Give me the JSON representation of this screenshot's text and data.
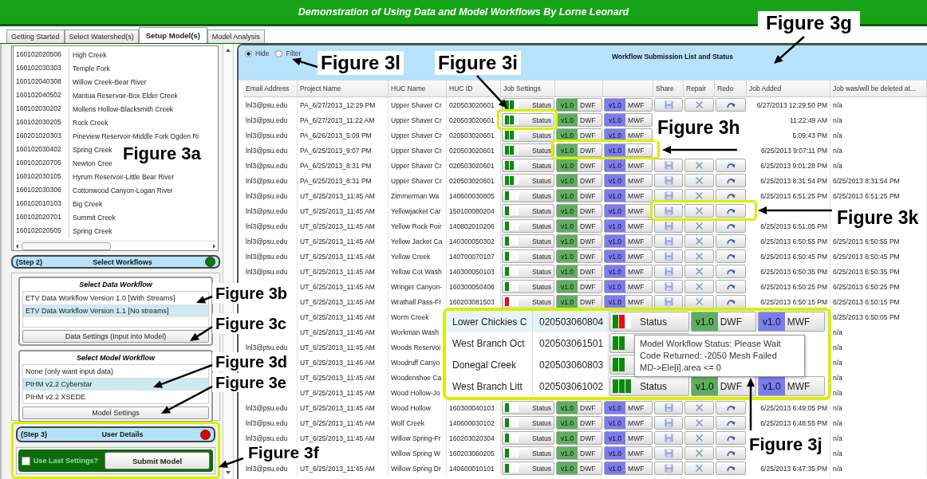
{
  "banner": {
    "title": "Demonstration of Using Data and Model Workflows By Lorne Leonard"
  },
  "tabs": [
    {
      "label": "Getting Started",
      "selected": false
    },
    {
      "label": "Select Watershed(s)",
      "selected": false
    },
    {
      "label": "Setup Model(s)",
      "selected": true
    },
    {
      "label": "Model Analysis",
      "selected": false
    }
  ],
  "watersheds": [
    {
      "id": "160102020506",
      "name": "High Creek"
    },
    {
      "id": "160102030303",
      "name": "Temple Fork"
    },
    {
      "id": "160102040308",
      "name": "Willow Creek-Bear River"
    },
    {
      "id": "160102040502",
      "name": "Mantua Reservoir-Box Elder Creek"
    },
    {
      "id": "160102030202",
      "name": "Mollens Hollow-Blacksmith Creek"
    },
    {
      "id": "160102030205",
      "name": "Rock Creek"
    },
    {
      "id": "160201020303",
      "name": "Pineview Reservoir-Middle Fork Ogden Ri"
    },
    {
      "id": "160102030402",
      "name": "Spring Creek"
    },
    {
      "id": "160102020705",
      "name": "Newton Cree"
    },
    {
      "id": "160102030105",
      "name": "Hyrum Reservoir-Little Bear River"
    },
    {
      "id": "160102030306",
      "name": "Cottonwood Canyon-Logan River"
    },
    {
      "id": "160102010103",
      "name": "Big Creek"
    },
    {
      "id": "160102020701",
      "name": "Summit Creek"
    },
    {
      "id": "160102020505",
      "name": "Spring Creek"
    }
  ],
  "step2": {
    "step": "(Step 2)",
    "title": "Select Workflows",
    "color": "#0a7a0a"
  },
  "data_workflow": {
    "title": "Select Data Workflow",
    "items": [
      {
        "label": "ETV Data Workflow Version 1.0 [With Streams]",
        "selected": false
      },
      {
        "label": "ETV Data Workflow Version 1.1 [No streams]",
        "selected": true
      }
    ],
    "button": "Data Settings (Input into Model)"
  },
  "model_workflow": {
    "title": "Select Model Workflow",
    "items": [
      {
        "label": "None (only want input data)",
        "selected": false
      },
      {
        "label": "PIHM v2.2 Cyberstar",
        "selected": true
      },
      {
        "label": "PIHM v2.2 XSEDE",
        "selected": false
      }
    ],
    "button": "Model Settings"
  },
  "step3": {
    "step": "(Step 3)",
    "title": "User Details",
    "color": "#e00000"
  },
  "user_details": {
    "checkbox": {
      "label": "Use Last Settings?",
      "checked": false
    },
    "button": "Submit Model"
  },
  "submissions": {
    "filter": [
      {
        "label": "Hide",
        "selected": true
      },
      {
        "label": "Filter",
        "selected": false
      }
    ],
    "title": "Workflow Submission List and Status",
    "headers": {
      "email": "Email Address",
      "project": "Project Name",
      "huc_name": "HUC Name",
      "huc_id": "HUC ID",
      "job_settings": "Job Settings",
      "share": "Share",
      "repair": "Repair",
      "redo": "Redo",
      "job_added": "Job Added",
      "job_deleted": "Job was/will be deleted at..."
    },
    "rows": [
      {
        "email": "lnl3@psu.edu",
        "project": "PA_6/27/2013_12:29 PM",
        "huc_name": "Upper Shaver Cr",
        "huc_id": "020503020601",
        "status": {
          "segments": [
            {
              "color": "#0b8a0b"
            },
            {
              "color": "#0b8a0b"
            },
            {
              "color": "#ffffff"
            }
          ],
          "label": "Status"
        },
        "dwf_version": "v1.0",
        "dwf": "DWF",
        "mwf_version": "v1.0",
        "mwf": "MWF",
        "tools": true,
        "job_added": "6/27/2013 12:29:50 PM",
        "job_deleted": "n/a"
      },
      {
        "email": "lnl3@psu.edu",
        "project": "PA_6/27/2013_11:22 AM",
        "huc_name": "Upper Shaver Cr",
        "huc_id": "020503020601",
        "status": {
          "segments": [
            {
              "color": "#0b8a0b"
            },
            {
              "color": "#0b8a0b"
            },
            {
              "color": "#ffffff"
            }
          ],
          "label": "Status"
        },
        "dwf_version": "v1.0",
        "dwf": "DWF",
        "mwf_version": "v1.0",
        "mwf": "MWF",
        "tools": false,
        "job_added": "11:22:49 AM",
        "job_deleted": "n/a"
      },
      {
        "email": "lnl3@psu.edu",
        "project": "PA_6/26/2013_5:09 PM",
        "huc_name": "Upper Shaver Cr",
        "huc_id": "020503020601",
        "status": {
          "segments": [
            {
              "color": "#0b8a0b"
            },
            {
              "color": "#0b8a0b"
            },
            {
              "color": "#ffffff"
            }
          ],
          "label": "Status"
        },
        "dwf_version": "v1.0",
        "dwf": "DWF",
        "mwf_version": "v1.0",
        "mwf": "MWF",
        "tools": false,
        "job_added": "5:09:43 PM",
        "job_deleted": "n/a"
      },
      {
        "email": "lnl3@psu.edu",
        "project": "PA_6/25/2013_9:07 PM",
        "huc_name": "Upper Shaver Cr",
        "huc_id": "020503020601",
        "status": {
          "segments": [
            {
              "color": "#0b8a0b"
            },
            {
              "color": "#0b8a0b"
            },
            {
              "color": "#ffffff"
            }
          ],
          "label": "Status"
        },
        "dwf_version": "v1.0",
        "dwf": "DWF",
        "mwf_version": "v1.0",
        "mwf": "MWF",
        "tools": false,
        "job_added": "6/25/2013 9:07:11 PM",
        "job_deleted": "n/a"
      },
      {
        "email": "lnl3@psu.edu",
        "project": "PA_6/25/2013_8:31 PM",
        "huc_name": "Upper Shaver Cr",
        "huc_id": "020503020601",
        "status": {
          "segments": [
            {
              "color": "#0b8a0b"
            },
            {
              "color": "#0b8a0b"
            },
            {
              "color": "#ffffff"
            }
          ],
          "label": "Status"
        },
        "dwf_version": "v1.0",
        "dwf": "DWF",
        "mwf_version": "v1.0",
        "mwf": "MWF",
        "tools": true,
        "job_added": "6/25/2013 9:01:28 PM",
        "job_deleted": "n/a"
      },
      {
        "email": "lnl3@psu.edu",
        "project": "PA_6/25/2013_8:31 PM",
        "huc_name": "Upper Shaver Cr",
        "huc_id": "020503020601",
        "status": {
          "segments": [
            {
              "color": "#0b8a0b"
            },
            {
              "color": "#0b8a0b"
            },
            {
              "color": "#ffffff"
            }
          ],
          "label": "Status"
        },
        "dwf_version": "v1.0",
        "dwf": "DWF",
        "mwf_version": "v1.0",
        "mwf": "MWF",
        "tools": true,
        "job_added": "6/25/2013 8:31:54 PM",
        "job_deleted": "6/25/2013 8:31:54 PM"
      },
      {
        "email": "lnl3@psu.edu",
        "project": "UT_6/25/2013_11:45 AM",
        "huc_name": "Zimmerman Wa",
        "huc_id": "140600030805",
        "status": {
          "segments": [
            {
              "color": "#0b8a0b"
            },
            {
              "color": "#ffffff"
            },
            {
              "color": "#ffffff"
            }
          ],
          "label": "Status"
        },
        "dwf_version": "v1.0",
        "dwf": "DWF",
        "mwf_version": "v1.0",
        "mwf": "MWF",
        "tools": true,
        "job_added": "6/25/2013 6:51:25 PM",
        "job_deleted": "6/25/2013 6:51:25 PM"
      },
      {
        "email": "lnl3@psu.edu",
        "project": "UT_6/25/2013_11:45 AM",
        "huc_name": "Yellowjacket Car",
        "huc_id": "150100080204",
        "status": {
          "segments": [
            {
              "color": "#0b8a0b"
            },
            {
              "color": "#ffffff"
            },
            {
              "color": "#ffffff"
            }
          ],
          "label": "Status"
        },
        "dwf_version": "v1.0",
        "dwf": "DWF",
        "mwf_version": "v1.0",
        "mwf": "MWF",
        "tools": true
      },
      {
        "email": "lnl3@psu.edu",
        "project": "UT_6/25/2013_11:45 AM",
        "huc_name": "Yellow Rock Poir",
        "huc_id": "140802010206",
        "status": {
          "segments": [
            {
              "color": "#0b8a0b"
            },
            {
              "color": "#ffffff"
            },
            {
              "color": "#ffffff"
            }
          ],
          "label": "Status"
        },
        "dwf_version": "v1.0",
        "dwf": "DWF",
        "mwf_version": "v1.0",
        "mwf": "MWF",
        "tools": true,
        "job_added": "6/25/2013 6:51:05 PM"
      },
      {
        "email": "lnl3@psu.edu",
        "project": "UT_6/25/2013_11:45 AM",
        "huc_name": "Yellow Jacket Ca",
        "huc_id": "140300050302",
        "status": {
          "segments": [
            {
              "color": "#0b8a0b"
            },
            {
              "color": "#ffffff"
            },
            {
              "color": "#ffffff"
            }
          ],
          "label": "Status"
        },
        "dwf_version": "v1.0",
        "dwf": "DWF",
        "mwf_version": "v1.0",
        "mwf": "MWF",
        "tools": true,
        "job_added": "6/25/2013 6:50:55 PM",
        "job_deleted": "6/25/2013 6:50:55 PM"
      },
      {
        "email": "lnl3@psu.edu",
        "project": "UT_6/25/2013_11:45 AM",
        "huc_name": "Yellow Creek",
        "huc_id": "140700070107",
        "status": {
          "segments": [
            {
              "color": "#0b8a0b"
            },
            {
              "color": "#ffffff"
            },
            {
              "color": "#ffffff"
            }
          ],
          "label": "Status"
        },
        "dwf_version": "v1.0",
        "dwf": "DWF",
        "mwf_version": "v1.0",
        "mwf": "MWF",
        "tools": true,
        "job_added": "6/25/2013 6:50:45 PM",
        "job_deleted": "6/25/2013 6:50:45 PM"
      },
      {
        "email": "lnl3@psu.edu",
        "project": "UT_6/25/2013_11:45 AM",
        "huc_name": "Yellow Cot Wash",
        "huc_id": "140300050103",
        "status": {
          "segments": [
            {
              "color": "#0b8a0b"
            },
            {
              "color": "#ffffff"
            },
            {
              "color": "#ffffff"
            }
          ],
          "label": "Status"
        },
        "dwf_version": "v1.0",
        "dwf": "DWF",
        "mwf_version": "v1.0",
        "mwf": "MWF",
        "tools": true,
        "job_added": "6/25/2013 6:50:35 PM",
        "job_deleted": "6/25/2013 6:50:35 PM"
      },
      {
        "project": "UT_6/25/2013_11:45 AM",
        "huc_name": "Wringer Canyon-",
        "huc_id": "160300050406",
        "status": {
          "segments": [
            {
              "color": "#0b8a0b"
            },
            {
              "color": "#ffffff"
            },
            {
              "color": "#ffffff"
            }
          ],
          "label": "Status"
        },
        "dwf_version": "v1.0",
        "dwf": "DWF",
        "mwf_version": "v1.0",
        "mwf": "MWF",
        "tools": true,
        "job_added": "6/25/2013 6:50:25 PM",
        "job_deleted": "6/25/2013 6:50:25 PM"
      },
      {
        "project": "UT_6/25/2013_11:45 AM",
        "huc_name": "Wrathall Pass-Fr",
        "huc_id": "160203081503",
        "status": {
          "segments": [
            {
              "color": "#e01010"
            },
            {
              "color": "#ffffff"
            },
            {
              "color": "#ffffff"
            }
          ],
          "label": "Status"
        },
        "dwf_version": "v1.0",
        "dwf": "DWF",
        "mwf_version": "v1.0",
        "mwf": "MWF",
        "tools": true,
        "job_added": "6/25/2013 6:50:15 PM",
        "job_deleted": "6/25/2013 6:50:15 PM"
      },
      {
        "project": "UT_6/25/2013_11:45 AM",
        "huc_name": "Worm Creek",
        "tools": false,
        "job_deleted": "6/25/2013 6:50:05 PM"
      },
      {
        "project": "UT_6/25/2013_11:45 AM",
        "huc_name": "Workman Wash",
        "tools": false,
        "job_deleted": "n/a"
      },
      {
        "email": "lnl3@psu.edu",
        "project": "UT_6/25/2013_11:45 AM",
        "huc_name": "Woods Reservoi",
        "tools": false,
        "job_deleted": "n/a"
      },
      {
        "project": "UT_6/25/2013_11:45 AM",
        "huc_name": "Woodruff Canyo",
        "tools": false,
        "job_deleted": "n/a"
      },
      {
        "project": "UT_6/25/2013_11:45 AM",
        "huc_name": "Woodenshoe Ca",
        "tools": false,
        "job_deleted": "n/a"
      },
      {
        "project": "UT_6/25/2013_11:45 AM",
        "huc_name": "Wood Hollow-Jo",
        "tools": false,
        "job_deleted": "n/a"
      },
      {
        "email": "lnl3@psu.edu",
        "project": "UT_6/25/2013_11:45 AM",
        "huc_name": "Wood Hollow",
        "huc_id": "160300040103",
        "status": {
          "segments": [
            {
              "color": "#0b8a0b"
            },
            {
              "color": "#ffffff"
            },
            {
              "color": "#ffffff"
            }
          ],
          "label": "Status"
        },
        "dwf_version": "v1.0",
        "dwf": "DWF",
        "mwf_version": "v1.0",
        "mwf": "MWF",
        "tools": true,
        "job_added": "6/25/2013 6:49:05 PM",
        "job_deleted": "n/a"
      },
      {
        "email": "lnl3@psu.edu",
        "project": "UT_6/25/2013_11:45 AM",
        "huc_name": "Wolf Creek",
        "huc_id": "140600030102",
        "status": {
          "segments": [
            {
              "color": "#0b8a0b"
            },
            {
              "color": "#ffffff"
            },
            {
              "color": "#ffffff"
            }
          ],
          "label": "Status"
        },
        "dwf_version": "v1.0",
        "dwf": "DWF",
        "mwf_version": "v1.0",
        "mwf": "MWF",
        "tools": true,
        "job_added": "6/25/2013 6:48:55 PM",
        "job_deleted": "n/a"
      },
      {
        "email": "lnl3@psu.edu",
        "project": "UT_6/25/2013_11:45 AM",
        "huc_name": "Willow Spring-Fr",
        "huc_id": "160203020304",
        "status": {
          "segments": [
            {
              "color": "#0b8a0b"
            },
            {
              "color": "#ffffff"
            },
            {
              "color": "#ffffff"
            }
          ],
          "label": "Status"
        },
        "dwf_version": "v1.0",
        "dwf": "DWF",
        "mwf_version": "v1.0",
        "mwf": "MWF",
        "tools": true,
        "job_deleted": "n/a"
      },
      {
        "huc_name": "Willow Spring W",
        "huc_id": "160203060205",
        "status": {
          "segments": [
            {
              "color": "#0b8a0b"
            },
            {
              "color": "#ffffff"
            },
            {
              "color": "#ffffff"
            }
          ],
          "label": "Status"
        },
        "dwf_version": "v1.0",
        "dwf": "DWF",
        "mwf_version": "v1.0",
        "mwf": "MWF",
        "tools": true,
        "job_deleted": "n/a"
      },
      {
        "email": "lnl3@psu.edu",
        "project": "UT_6/25/2013_11:45 AM",
        "huc_name": "Willow Spring Dr",
        "huc_id": "140600010101",
        "status": {
          "segments": [
            {
              "color": "#0b8a0b"
            },
            {
              "color": "#ffffff"
            },
            {
              "color": "#ffffff"
            }
          ],
          "label": "Status"
        },
        "dwf_version": "v1.0",
        "dwf": "DWF",
        "mwf_version": "v1.0",
        "mwf": "MWF",
        "tools": true,
        "job_added": "6/25/2013 6:47:35 PM",
        "job_deleted": "n/a"
      }
    ]
  },
  "inset": {
    "rows": [
      {
        "selected": true,
        "huc_name": "Lower Chickies C",
        "huc_id": "020503060804",
        "status": {
          "segments": [
            {
              "color": "#0b8a0b"
            },
            {
              "color": "#e01010"
            },
            {
              "color": "#ffffff"
            }
          ],
          "label": "Status"
        },
        "dwf_version": "v1.0",
        "dwf": "DWF",
        "mwf_version": "v1.0",
        "mwf": "MWF"
      },
      {
        "selected": false,
        "huc_name": "West Branch Oct",
        "huc_id": "020503061501",
        "status": {
          "segments": [
            {
              "color": "#0b8a0b"
            },
            {
              "color": "#0b8a0b"
            }
          ]
        }
      },
      {
        "selected": false,
        "huc_name": "Donegal Creek",
        "huc_id": "020503060803",
        "status": {
          "segments": [
            {
              "color": "#0b8a0b"
            },
            {
              "color": "#0b8a0b"
            }
          ]
        }
      },
      {
        "selected": false,
        "huc_name": "West Branch Litt",
        "huc_id": "020503061002",
        "status": {
          "segments": [
            {
              "color": "#0b8a0b"
            },
            {
              "color": "#0b8a0b"
            },
            {
              "color": "#0b8a0b"
            }
          ],
          "label": "Status"
        },
        "dwf_version": "v1.0",
        "dwf": "DWF",
        "mwf_version": "v1.0",
        "mwf": "MWF"
      }
    ],
    "tooltip": [
      "Model Workflow Status: Please Wait",
      "Code Returned: -2050 Mesh Failed",
      "MD->Ele[i].area <= 0"
    ]
  },
  "annotations": [
    {
      "label": "Figure 3g"
    },
    {
      "label": "Figure 3l"
    },
    {
      "label": "Figure 3i"
    },
    {
      "label": "Figure 3a"
    },
    {
      "label": "Figure 3h"
    },
    {
      "label": "Figure 3k"
    },
    {
      "label": "Figure 3b"
    },
    {
      "label": "Figure 3c"
    },
    {
      "label": "Figure 3d"
    },
    {
      "label": "Figure 3e"
    },
    {
      "label": "Figure 3j"
    },
    {
      "label": "Figure 3f"
    }
  ]
}
